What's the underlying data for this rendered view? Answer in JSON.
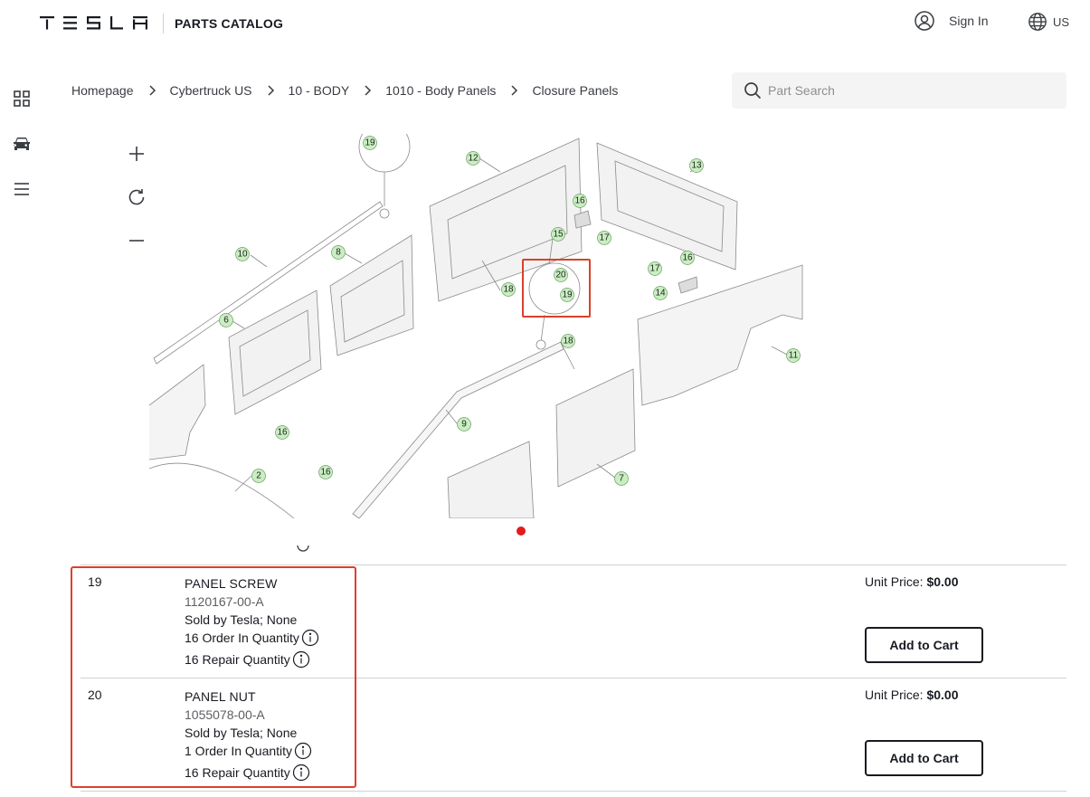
{
  "header": {
    "logo_text": "TESLA",
    "title": "PARTS CATALOG",
    "signin_label": "Sign In",
    "locale_label": "US"
  },
  "icons": {
    "logo": "tesla-wordmark-logo",
    "account": "user-circle-icon",
    "locale": "globe-icon",
    "rail": [
      "grid-icon",
      "car-icon",
      "menu-icon"
    ],
    "search": "search-icon",
    "zoom": [
      "plus-icon",
      "rotate-icon",
      "minus-icon"
    ],
    "separator": "chevron-right-icon",
    "info": "info-circle-icon"
  },
  "breadcrumb": [
    "Homepage",
    "Cybertruck US",
    "10 - BODY",
    "1010 - Body Panels",
    "Closure Panels"
  ],
  "search": {
    "placeholder": "Part Search",
    "value": ""
  },
  "diagram": {
    "callouts": [
      "19",
      "12",
      "13",
      "16",
      "15",
      "17",
      "10",
      "8",
      "18",
      "20",
      "19",
      "17",
      "16",
      "14",
      "6",
      "18",
      "11",
      "9",
      "16",
      "2",
      "16",
      "7"
    ],
    "highlighted_callouts": [
      "20",
      "19"
    ],
    "carousel_active_index": 1
  },
  "parts": [
    {
      "number": "19",
      "name": "PANEL SCREW",
      "part_number": "1120167-00-A",
      "sold_by": "Sold by Tesla; None",
      "order_qty": "16 Order In Quantity",
      "repair_qty": "16 Repair Quantity",
      "price_label": "Unit Price:",
      "price_value": "$0.00",
      "button_label": "Add to Cart"
    },
    {
      "number": "20",
      "name": "PANEL NUT",
      "part_number": "1055078-00-A",
      "sold_by": "Sold by Tesla; None",
      "order_qty": "1 Order In Quantity",
      "repair_qty": "16 Repair Quantity",
      "price_label": "Unit Price:",
      "price_value": "$0.00",
      "button_label": "Add to Cart"
    }
  ],
  "colors": {
    "text": "#171a20",
    "highlight": "#d9412c",
    "callout_fill": "#c9eec1",
    "carousel_dot": "#e31b1b",
    "search_bg": "#f4f4f4"
  }
}
